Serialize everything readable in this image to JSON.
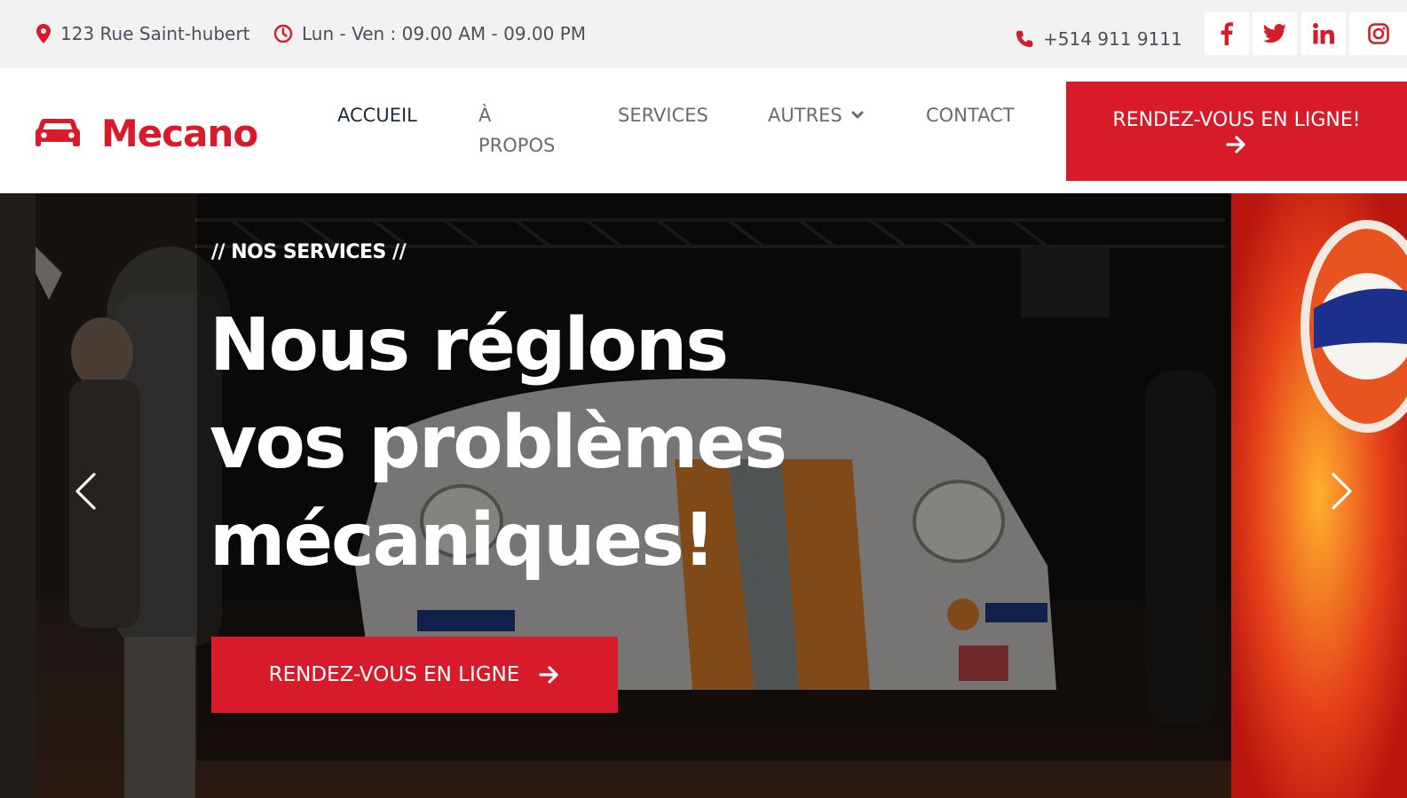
{
  "topbar": {
    "address": "123 Rue Saint-hubert",
    "hours": "Lun - Ven : 09.00 AM - 09.00 PM",
    "phone": "+514 911 9111",
    "social": [
      "facebook-icon",
      "twitter-icon",
      "linkedin-icon",
      "instagram-icon"
    ]
  },
  "brand": {
    "name": "Mecano",
    "accent": "#d71b2a"
  },
  "nav": {
    "accueil": "ACCUEIL",
    "apropos_line1": "À",
    "apropos_line2": "PROPOS",
    "services": "SERVICES",
    "autres": "AUTRES",
    "contact": "CONTACT",
    "cta": "RENDEZ-VOUS EN LIGNE!"
  },
  "hero": {
    "eyebrow": "// NOS SERVICES //",
    "headline_line1": "Nous réglons",
    "headline_line2": "vos problèmes",
    "headline_line3": "mécaniques!",
    "cta": "RENDEZ-VOUS EN LIGNE"
  }
}
